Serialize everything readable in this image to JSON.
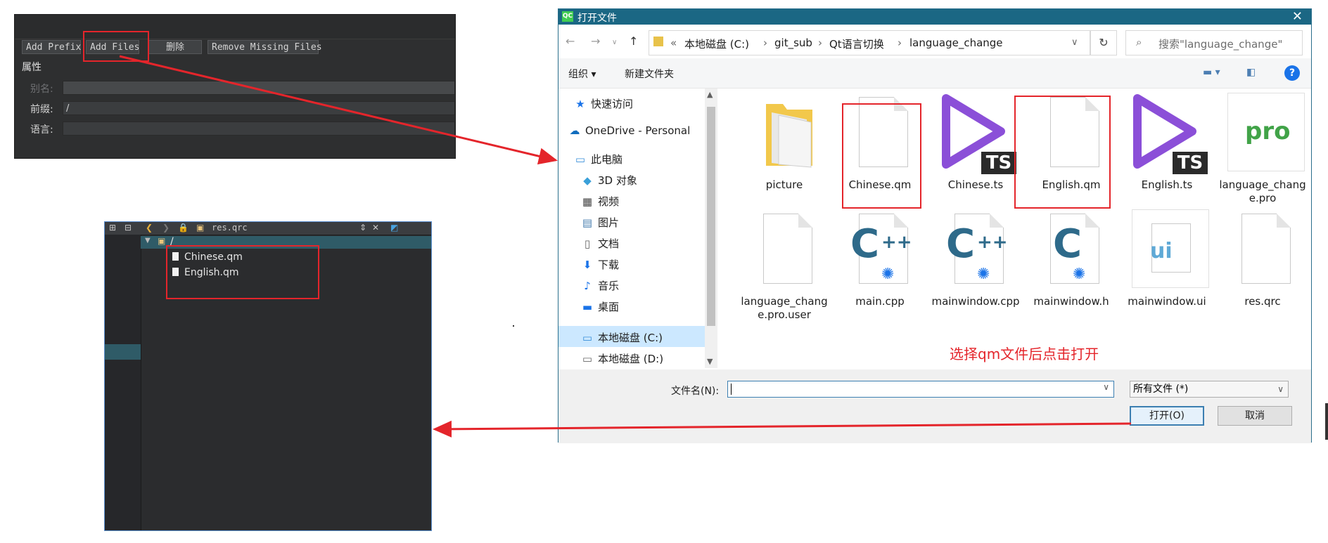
{
  "resource_editor": {
    "buttons": [
      "Add Prefix",
      "Add Files",
      "删除",
      "Remove Missing Files"
    ],
    "section_title": "属性",
    "alias_label": "别名:",
    "prefix_label": "前缀:",
    "prefix_value": "/",
    "language_label": "语言:"
  },
  "project_tree": {
    "open_file": "res.qrc",
    "root_prefix": "/",
    "files": [
      "Chinese.qm",
      "English.qm"
    ]
  },
  "dialog": {
    "title": "打开文件",
    "breadcrumb": [
      "«",
      "本地磁盘 (C:)",
      "git_sub",
      "Qt语言切换",
      "language_change"
    ],
    "search_placeholder": "搜索\"language_change\"",
    "organize": "组织 ▾",
    "new_folder": "新建文件夹",
    "help": "?",
    "nav_items": [
      {
        "icon": "star-icon",
        "label": "快速访问"
      },
      {
        "icon": "onedrive-icon",
        "label": "OneDrive - Personal"
      },
      {
        "icon": "pc-icon",
        "label": "此电脑"
      },
      {
        "icon": "3d-objects-icon",
        "label": "3D 对象"
      },
      {
        "icon": "video-icon",
        "label": "视频"
      },
      {
        "icon": "pictures-icon",
        "label": "图片"
      },
      {
        "icon": "documents-icon",
        "label": "文档"
      },
      {
        "icon": "downloads-icon",
        "label": "下载"
      },
      {
        "icon": "music-icon",
        "label": "音乐"
      },
      {
        "icon": "desktop-icon",
        "label": "桌面"
      },
      {
        "icon": "drive-c-icon",
        "label": "本地磁盘 (C:)"
      },
      {
        "icon": "drive-d-icon",
        "label": "本地磁盘 (D:)"
      }
    ],
    "files": [
      {
        "name": "picture",
        "type": "folder"
      },
      {
        "name": "Chinese.qm",
        "type": "doc"
      },
      {
        "name": "Chinese.ts",
        "type": "ts"
      },
      {
        "name": "English.qm",
        "type": "doc"
      },
      {
        "name": "English.ts",
        "type": "ts"
      },
      {
        "name": "language_change.pro",
        "type": "pro"
      },
      {
        "name": "language_change.pro.user",
        "type": "doc"
      },
      {
        "name": "main.cpp",
        "type": "cpp"
      },
      {
        "name": "mainwindow.cpp",
        "type": "cpp"
      },
      {
        "name": "mainwindow.h",
        "type": "h"
      },
      {
        "name": "mainwindow.ui",
        "type": "ui"
      },
      {
        "name": "res.qrc",
        "type": "doc"
      }
    ],
    "filename_label": "文件名(N):",
    "filename_value": "",
    "filter_value": "所有文件 (*)",
    "open_button": "打开(O)",
    "cancel_button": "取消"
  },
  "annotation": "选择qm文件后点击打开",
  "colors": {
    "highlight_red": "#e4252b",
    "qtc_dark": "#2e2f30",
    "dialog_titlebar": "#1b6784",
    "selection_blue": "#cce8ff"
  }
}
